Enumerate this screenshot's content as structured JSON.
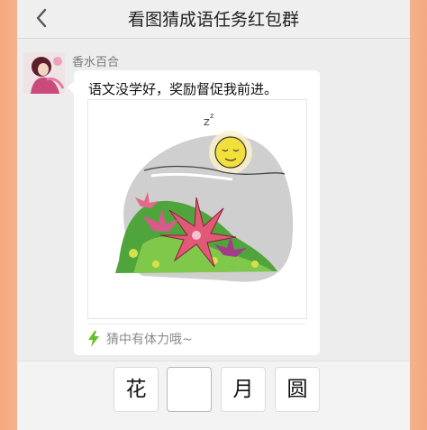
{
  "header": {
    "back_icon": "chevron-left-icon",
    "title": "看图猜成语任务红包群"
  },
  "message": {
    "sender": "香水百合",
    "text": "语文没学好，奖励督促我前进。",
    "picture": "idiom-picture",
    "hint_icon": "lightning-icon",
    "hint": "猜中有体力哦~"
  },
  "answer": {
    "chars": [
      "花",
      "",
      "月",
      "圆"
    ]
  },
  "colors": {
    "bubble": "#ffffff",
    "background": "#ededed",
    "hint_icon": "#6bbd2b"
  }
}
